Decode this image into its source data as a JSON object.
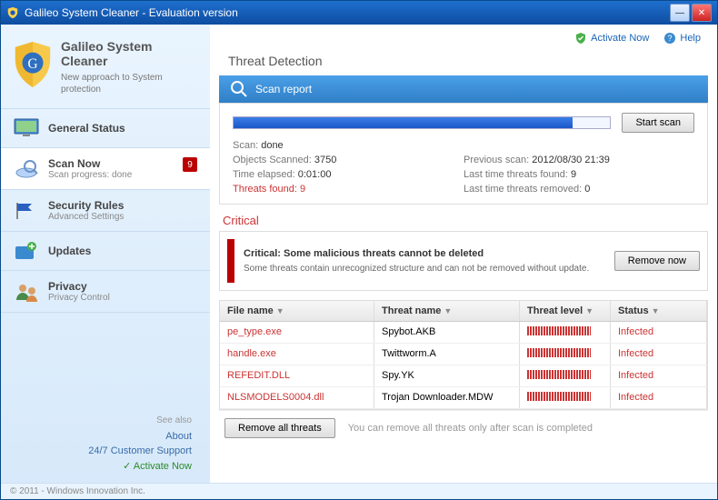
{
  "window": {
    "title": "Galileo System Cleaner - Evaluation version"
  },
  "brand": {
    "title1": "Galileo System",
    "title2": "Cleaner",
    "sub": "New approach to System protection"
  },
  "toplinks": {
    "activate": "Activate Now",
    "help": "Help"
  },
  "nav": {
    "general": {
      "label": "General Status"
    },
    "scan": {
      "label": "Scan Now",
      "sub": "Scan progress: done",
      "badge": "9"
    },
    "rules": {
      "label": "Security Rules",
      "sub": "Advanced Settings"
    },
    "updates": {
      "label": "Updates"
    },
    "privacy": {
      "label": "Privacy",
      "sub": "Privacy Control"
    }
  },
  "seealso": {
    "hd": "See also",
    "about": "About",
    "support": "24/7 Customer Support",
    "activate": "Activate Now"
  },
  "main": {
    "heading": "Threat Detection",
    "reportbar": "Scan report",
    "start_btn": "Start scan",
    "scan_label": "Scan:",
    "scan_val": "done",
    "obj_label": "Objects Scanned:",
    "obj_val": "3750",
    "time_label": "Time elapsed:",
    "time_val": "0:01:00",
    "found_label": "Threats found:",
    "found_val": "9",
    "prev_label": "Previous scan:",
    "prev_val": "2012/08/30 21:39",
    "lastf_label": "Last time threats found:",
    "lastf_val": "9",
    "lastr_label": "Last time threats removed:",
    "lastr_val": "0",
    "crit_heading": "Critical",
    "crit_title": "Critical: Some malicious threats cannot be deleted",
    "crit_sub": "Some threats contain unrecognized structure and can not be removed without update.",
    "remove_now": "Remove now",
    "cols": {
      "file": "File name",
      "threat": "Threat name",
      "level": "Threat level",
      "status": "Status"
    },
    "rows": [
      {
        "file": "pe_type.exe",
        "threat": "Spybot.AKB",
        "status": "Infected"
      },
      {
        "file": "handle.exe",
        "threat": "Twittworm.A",
        "status": "Infected"
      },
      {
        "file": "REFEDIT.DLL",
        "threat": "Spy.YK",
        "status": "Infected"
      },
      {
        "file": "NLSMODELS0004.dll",
        "threat": "Trojan Downloader.MDW",
        "status": "Infected"
      }
    ],
    "remove_all": "Remove all threats",
    "remove_note": "You can remove all threats only after scan is completed"
  },
  "copyright": "© 2011 - Windows Innovation Inc."
}
